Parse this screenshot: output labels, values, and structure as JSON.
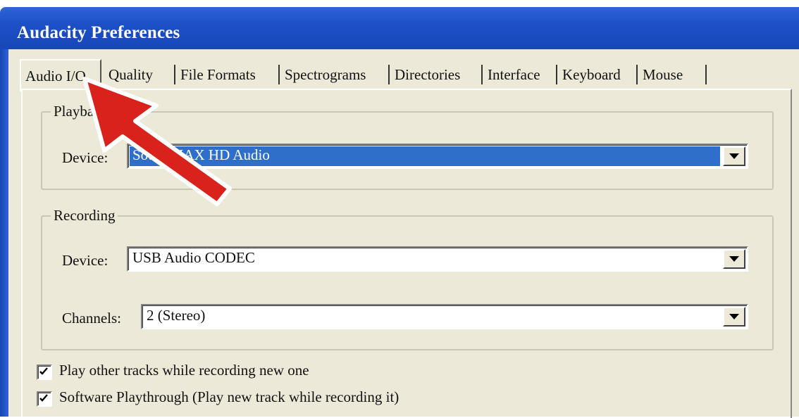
{
  "window": {
    "title": "Audacity Preferences"
  },
  "tabs": [
    {
      "label": "Audio I/O",
      "active": true
    },
    {
      "label": "Quality"
    },
    {
      "label": "File Formats"
    },
    {
      "label": "Spectrograms"
    },
    {
      "label": "Directories"
    },
    {
      "label": "Interface"
    },
    {
      "label": "Keyboard"
    },
    {
      "label": "Mouse"
    }
  ],
  "playback": {
    "legend": "Playback",
    "device_label": "Device:",
    "device_value": "SoundMAX HD Audio"
  },
  "recording": {
    "legend": "Recording",
    "device_label": "Device:",
    "device_value": "USB Audio CODEC",
    "channels_label": "Channels:",
    "channels_value": "2 (Stereo)"
  },
  "options": {
    "play_other_tracks": {
      "label": "Play other tracks while recording new one",
      "checked": true
    },
    "software_playthrough": {
      "label": "Software Playthrough (Play new track while recording it)",
      "checked": true
    }
  },
  "annotation": {
    "arrow_color": "#d9221c",
    "icon": "red-arrow-pointer"
  }
}
